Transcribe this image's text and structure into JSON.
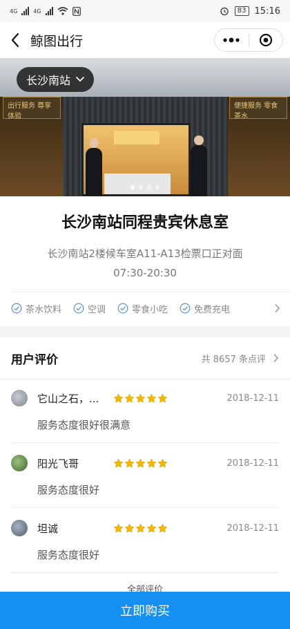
{
  "status_bar": {
    "network_left": "4G",
    "network_right": "4G",
    "battery": "83",
    "time": "15:16"
  },
  "nav": {
    "title": "鲸图出行"
  },
  "hero": {
    "station": "长沙南站",
    "sign_left": "出行服务 尊享体验",
    "sign_right": "便捷服务 零食茶水",
    "slide_count": 4,
    "active_slide": 0
  },
  "lounge": {
    "title": "长沙南站同程贵宾休息室",
    "address": "长沙南站2楼候车室A11-A13检票口正对面",
    "hours": "07:30-20:30"
  },
  "amenities": [
    {
      "label": "茶水饮料"
    },
    {
      "label": "空调"
    },
    {
      "label": "零食小吃"
    },
    {
      "label": "免费充电"
    }
  ],
  "reviews_section": {
    "title": "用户评价",
    "count_label": "共 8657 条点评"
  },
  "reviews": [
    {
      "name": "它山之石，...",
      "stars": 5,
      "date": "2018-12-11",
      "text": "服务态度很好很满意",
      "avatar_color": "#9aa3ad"
    },
    {
      "name": "阳光飞哥",
      "stars": 5,
      "date": "2018-12-11",
      "text": "服务态度很好",
      "avatar_color": "#5b8a4a"
    },
    {
      "name": "坦诚",
      "stars": 5,
      "date": "2018-12-11",
      "text": "服务态度很好",
      "avatar_color": "#6e7f95"
    }
  ],
  "all_reviews_label": "全部评价",
  "buy_button": {
    "label": "立即购买"
  },
  "colors": {
    "accent": "#1590f2",
    "star": "#f5b800",
    "check": "#6f9fd0"
  }
}
